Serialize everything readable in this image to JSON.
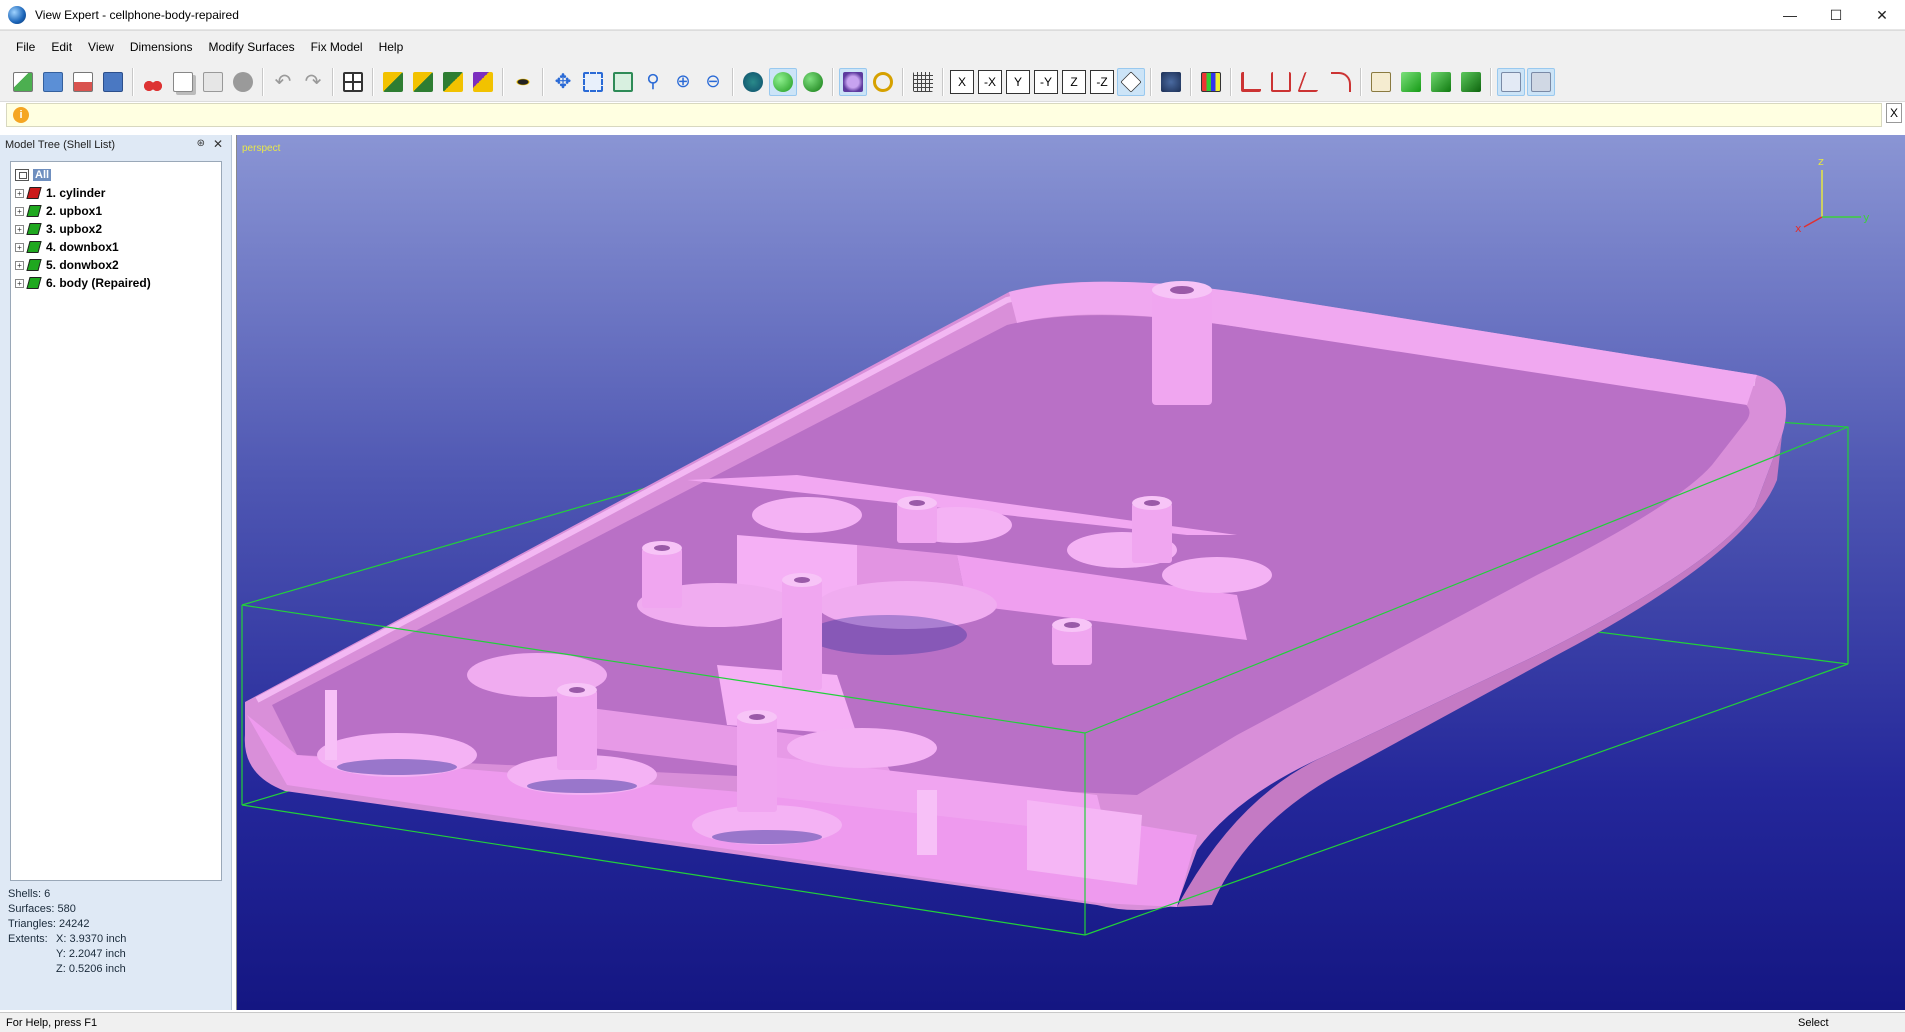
{
  "window": {
    "title": "View Expert - cellphone-body-repaired",
    "controls": [
      "minimize",
      "maximize",
      "close"
    ]
  },
  "menu": [
    "File",
    "Edit",
    "View",
    "Dimensions",
    "Modify Surfaces",
    "Fix Model",
    "Help"
  ],
  "info_bar": {
    "message": "",
    "close_label": "X"
  },
  "model_tree": {
    "title": "Model Tree (Shell List)",
    "root_label": "All",
    "shells": [
      {
        "label": "1. cylinder",
        "color": "#cc1a1a"
      },
      {
        "label": "2. upbox1",
        "color": "#1fa81f"
      },
      {
        "label": "3. upbox2",
        "color": "#1fa81f"
      },
      {
        "label": "4. downbox1",
        "color": "#1fa81f"
      },
      {
        "label": "5. donwbox2",
        "color": "#1fa81f"
      },
      {
        "label": "6. body (Repaired)",
        "color": "#1fa81f"
      }
    ]
  },
  "stats": {
    "shells": "Shells: 6",
    "surfaces": "Surfaces: 580",
    "triangles": "Triangles: 24242",
    "extents_label": "Extents:",
    "x": "X: 3.9370 inch",
    "y": "Y: 2.2047 inch",
    "z": "Z: 0.5206 inch"
  },
  "viewport": {
    "projection": "perspect",
    "axis_labels": {
      "x": "x",
      "y": "y",
      "z": "z"
    },
    "model_color": "#e69be6",
    "bbox_color": "#22d03a"
  },
  "status": {
    "help": "For Help, press F1",
    "mode": "Select"
  },
  "colors": {
    "accent": "#cce4f7",
    "panel_bg": "#dfe9f5",
    "info_bg": "#ffffe1"
  }
}
